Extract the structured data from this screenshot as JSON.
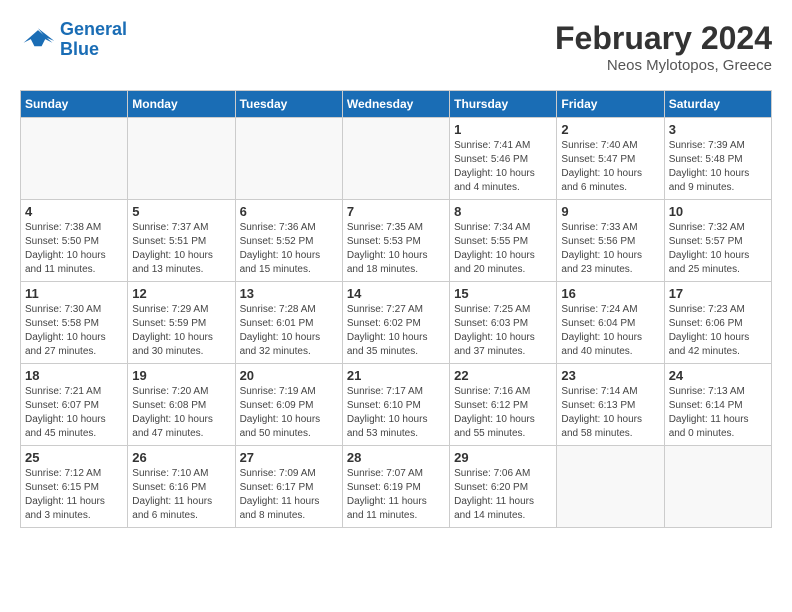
{
  "header": {
    "logo_line1": "General",
    "logo_line2": "Blue",
    "month_title": "February 2024",
    "location": "Neos Mylotopos, Greece"
  },
  "weekdays": [
    "Sunday",
    "Monday",
    "Tuesday",
    "Wednesday",
    "Thursday",
    "Friday",
    "Saturday"
  ],
  "weeks": [
    [
      {
        "day": "",
        "info": ""
      },
      {
        "day": "",
        "info": ""
      },
      {
        "day": "",
        "info": ""
      },
      {
        "day": "",
        "info": ""
      },
      {
        "day": "1",
        "info": "Sunrise: 7:41 AM\nSunset: 5:46 PM\nDaylight: 10 hours\nand 4 minutes."
      },
      {
        "day": "2",
        "info": "Sunrise: 7:40 AM\nSunset: 5:47 PM\nDaylight: 10 hours\nand 6 minutes."
      },
      {
        "day": "3",
        "info": "Sunrise: 7:39 AM\nSunset: 5:48 PM\nDaylight: 10 hours\nand 9 minutes."
      }
    ],
    [
      {
        "day": "4",
        "info": "Sunrise: 7:38 AM\nSunset: 5:50 PM\nDaylight: 10 hours\nand 11 minutes."
      },
      {
        "day": "5",
        "info": "Sunrise: 7:37 AM\nSunset: 5:51 PM\nDaylight: 10 hours\nand 13 minutes."
      },
      {
        "day": "6",
        "info": "Sunrise: 7:36 AM\nSunset: 5:52 PM\nDaylight: 10 hours\nand 15 minutes."
      },
      {
        "day": "7",
        "info": "Sunrise: 7:35 AM\nSunset: 5:53 PM\nDaylight: 10 hours\nand 18 minutes."
      },
      {
        "day": "8",
        "info": "Sunrise: 7:34 AM\nSunset: 5:55 PM\nDaylight: 10 hours\nand 20 minutes."
      },
      {
        "day": "9",
        "info": "Sunrise: 7:33 AM\nSunset: 5:56 PM\nDaylight: 10 hours\nand 23 minutes."
      },
      {
        "day": "10",
        "info": "Sunrise: 7:32 AM\nSunset: 5:57 PM\nDaylight: 10 hours\nand 25 minutes."
      }
    ],
    [
      {
        "day": "11",
        "info": "Sunrise: 7:30 AM\nSunset: 5:58 PM\nDaylight: 10 hours\nand 27 minutes."
      },
      {
        "day": "12",
        "info": "Sunrise: 7:29 AM\nSunset: 5:59 PM\nDaylight: 10 hours\nand 30 minutes."
      },
      {
        "day": "13",
        "info": "Sunrise: 7:28 AM\nSunset: 6:01 PM\nDaylight: 10 hours\nand 32 minutes."
      },
      {
        "day": "14",
        "info": "Sunrise: 7:27 AM\nSunset: 6:02 PM\nDaylight: 10 hours\nand 35 minutes."
      },
      {
        "day": "15",
        "info": "Sunrise: 7:25 AM\nSunset: 6:03 PM\nDaylight: 10 hours\nand 37 minutes."
      },
      {
        "day": "16",
        "info": "Sunrise: 7:24 AM\nSunset: 6:04 PM\nDaylight: 10 hours\nand 40 minutes."
      },
      {
        "day": "17",
        "info": "Sunrise: 7:23 AM\nSunset: 6:06 PM\nDaylight: 10 hours\nand 42 minutes."
      }
    ],
    [
      {
        "day": "18",
        "info": "Sunrise: 7:21 AM\nSunset: 6:07 PM\nDaylight: 10 hours\nand 45 minutes."
      },
      {
        "day": "19",
        "info": "Sunrise: 7:20 AM\nSunset: 6:08 PM\nDaylight: 10 hours\nand 47 minutes."
      },
      {
        "day": "20",
        "info": "Sunrise: 7:19 AM\nSunset: 6:09 PM\nDaylight: 10 hours\nand 50 minutes."
      },
      {
        "day": "21",
        "info": "Sunrise: 7:17 AM\nSunset: 6:10 PM\nDaylight: 10 hours\nand 53 minutes."
      },
      {
        "day": "22",
        "info": "Sunrise: 7:16 AM\nSunset: 6:12 PM\nDaylight: 10 hours\nand 55 minutes."
      },
      {
        "day": "23",
        "info": "Sunrise: 7:14 AM\nSunset: 6:13 PM\nDaylight: 10 hours\nand 58 minutes."
      },
      {
        "day": "24",
        "info": "Sunrise: 7:13 AM\nSunset: 6:14 PM\nDaylight: 11 hours\nand 0 minutes."
      }
    ],
    [
      {
        "day": "25",
        "info": "Sunrise: 7:12 AM\nSunset: 6:15 PM\nDaylight: 11 hours\nand 3 minutes."
      },
      {
        "day": "26",
        "info": "Sunrise: 7:10 AM\nSunset: 6:16 PM\nDaylight: 11 hours\nand 6 minutes."
      },
      {
        "day": "27",
        "info": "Sunrise: 7:09 AM\nSunset: 6:17 PM\nDaylight: 11 hours\nand 8 minutes."
      },
      {
        "day": "28",
        "info": "Sunrise: 7:07 AM\nSunset: 6:19 PM\nDaylight: 11 hours\nand 11 minutes."
      },
      {
        "day": "29",
        "info": "Sunrise: 7:06 AM\nSunset: 6:20 PM\nDaylight: 11 hours\nand 14 minutes."
      },
      {
        "day": "",
        "info": ""
      },
      {
        "day": "",
        "info": ""
      }
    ]
  ]
}
